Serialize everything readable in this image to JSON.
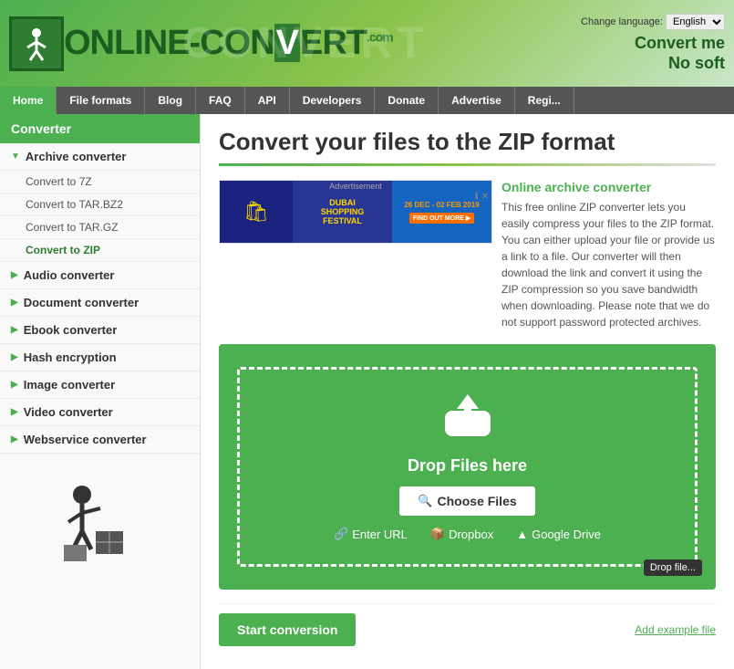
{
  "meta": {
    "language_label": "Change language:",
    "language_value": "English"
  },
  "header": {
    "logo_text_before": "ONLINE-CON",
    "logo_text_highlight": "V",
    "logo_text_after": "ERT",
    "logo_com": ".COM",
    "convert_line1": "Convert me",
    "convert_line2": "No soft",
    "watermark": "CONVERT"
  },
  "nav": {
    "items": [
      {
        "label": "Home",
        "active": false
      },
      {
        "label": "File formats",
        "active": false
      },
      {
        "label": "Blog",
        "active": false
      },
      {
        "label": "FAQ",
        "active": false
      },
      {
        "label": "API",
        "active": false
      },
      {
        "label": "Developers",
        "active": false
      },
      {
        "label": "Donate",
        "active": false
      },
      {
        "label": "Advertise",
        "active": false
      },
      {
        "label": "Regi...",
        "active": false
      }
    ]
  },
  "sidebar": {
    "title": "Converter",
    "sections": [
      {
        "label": "Archive converter",
        "expanded": true,
        "children": [
          {
            "label": "Convert to 7Z"
          },
          {
            "label": "Convert to TAR.BZ2"
          },
          {
            "label": "Convert to TAR.GZ"
          },
          {
            "label": "Convert to ZIP",
            "active": true
          }
        ]
      },
      {
        "label": "Audio converter",
        "expanded": false,
        "children": []
      },
      {
        "label": "Document converter",
        "expanded": false,
        "children": []
      },
      {
        "label": "Ebook converter",
        "expanded": false,
        "children": []
      },
      {
        "label": "Hash encryption",
        "expanded": false,
        "children": []
      },
      {
        "label": "Image converter",
        "expanded": false,
        "children": []
      },
      {
        "label": "Video converter",
        "expanded": false,
        "children": []
      },
      {
        "label": "Webservice converter",
        "expanded": false,
        "children": []
      }
    ]
  },
  "content": {
    "title": "Convert your files to the ZIP format",
    "ad": {
      "label": "Advertisement",
      "brand": "DUBAI\nSHOPPING\nFESTIVAL",
      "date": "26 DEC - 02 FEB 2019",
      "btn": "FIND OUT MORE ▶"
    },
    "description": {
      "title": "Online archive converter",
      "text": "This free online ZIP converter lets you easily compress your files to the ZIP format. You can either upload your file or provide us a link to a file. Our converter will then download the link and convert it using the ZIP compression so you save bandwidth when downloading. Please note that we do not support password protected archives."
    },
    "dropzone": {
      "drop_text": "Drop Files here",
      "choose_label": "Choose Files",
      "enter_url": "Enter URL",
      "dropbox": "Dropbox",
      "google_drive": "Google Drive",
      "tooltip": "Drop file..."
    },
    "start_btn": "Start conversion",
    "add_example": "Add example file"
  }
}
